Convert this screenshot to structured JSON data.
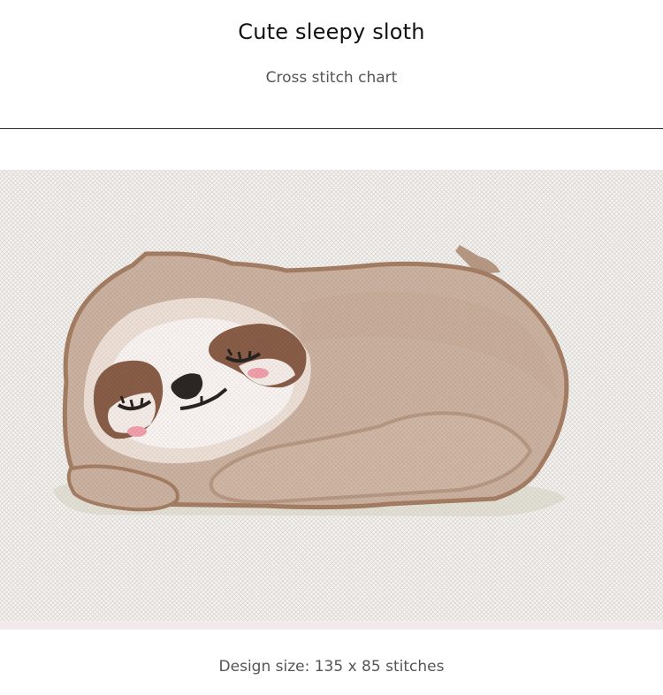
{
  "header": {
    "title": "Cute sleepy sloth",
    "subtitle": "Cross stitch chart"
  },
  "artwork": {
    "icon": "sleepy-sloth-cross-stitch",
    "colors": {
      "fabric": "#f6f4f2",
      "body": "#cdb3a1",
      "body_dark": "#b99a85",
      "outline": "#a77f64",
      "face": "#f7eeea",
      "face_white": "#fdfbfa",
      "eye_patch": "#8a5e48",
      "eye_line": "#2a2320",
      "nose": "#2c2624",
      "blush": "#f2a1ad",
      "shadow": "#e5e1d6"
    }
  },
  "footer": {
    "design_size": "Design size: 135 x 85 stitches"
  }
}
